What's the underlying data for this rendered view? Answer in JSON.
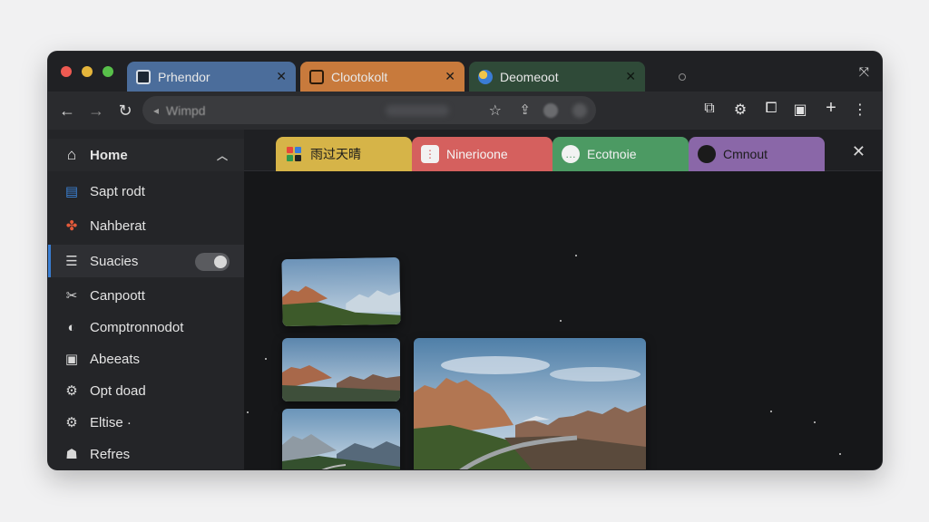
{
  "browser": {
    "tabs": [
      {
        "label": "Prhendor"
      },
      {
        "label": "Clootokolt"
      },
      {
        "label": "Deomeoot"
      }
    ],
    "address_bar": {
      "text": "Wimpd"
    }
  },
  "sidebar": {
    "items": [
      {
        "label": "Home",
        "icon": "home-icon"
      },
      {
        "label": "Sapt rodt",
        "icon": "document-icon"
      },
      {
        "label": "Nahberat",
        "icon": "pinwheel-icon"
      },
      {
        "label": "Suacies",
        "icon": "list-icon"
      },
      {
        "label": "Canpoott",
        "icon": "tools-icon"
      },
      {
        "label": "Comptronnodot",
        "icon": "compass-icon"
      },
      {
        "label": "Abeeats",
        "icon": "bag-icon"
      },
      {
        "label": "Opt doad",
        "icon": "gear-icon"
      },
      {
        "label": "Eltise ·",
        "icon": "settings-icon"
      },
      {
        "label": "Refres",
        "icon": "users-icon"
      }
    ]
  },
  "content_tabs": [
    {
      "label": "雨过天晴",
      "color": "#d6b448"
    },
    {
      "label": "Ninerioone",
      "color": "#d5605e"
    },
    {
      "label": "Ecotnoie",
      "color": "#4c9a63"
    },
    {
      "label": "Cmnout",
      "color": "#8a67a8"
    }
  ],
  "gallery": {
    "images": [
      "mountain-landscape",
      "mountain-landscape",
      "mountain-landscape",
      "mountain-landscape",
      "mountain-landscape"
    ]
  }
}
